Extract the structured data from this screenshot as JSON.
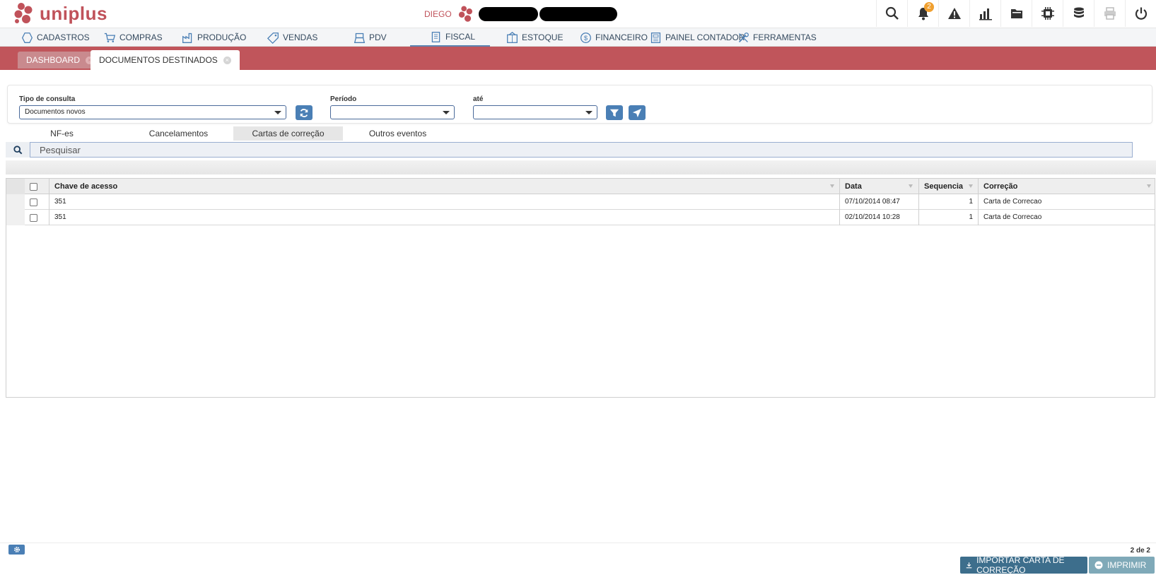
{
  "app": {
    "brand": "uniplus",
    "user_name": "DIEGO",
    "notification_count": "2",
    "brand_color": "#c0525a"
  },
  "top_icons": [
    "search-icon",
    "bell-icon",
    "warning-icon",
    "chart-icon",
    "folder-icon",
    "chip-icon",
    "database-icon",
    "printer-icon",
    "power-icon"
  ],
  "menu": {
    "cadastros": "CADASTROS",
    "compras": "COMPRAS",
    "producao": "PRODUÇÃO",
    "vendas": "VENDAS",
    "pdv": "PDV",
    "fiscal": "FISCAL",
    "estoque": "ESTOQUE",
    "financeiro": "FINANCEIRO",
    "painel_contador": "PAINEL CONTADOR",
    "ferramentas": "FERRAMENTAS",
    "active": "FISCAL"
  },
  "tabs": {
    "dashboard": "DASHBOARD",
    "documentos": "DOCUMENTOS DESTINADOS"
  },
  "filters": {
    "tipo_label": "Tipo de consulta",
    "tipo_value": "Documentos novos",
    "periodo_label": "Período",
    "periodo_value": "",
    "ate_label": "até",
    "ate_value": ""
  },
  "subtabs": {
    "nfes": "NF-es",
    "cancelamentos": "Cancelamentos",
    "cartas": "Cartas de correção",
    "outros": "Outros eventos",
    "active": "Cartas de correção"
  },
  "search": {
    "placeholder": "Pesquisar"
  },
  "grid": {
    "columns": {
      "chave": "Chave de acesso",
      "data": "Data",
      "sequencia": "Sequencia",
      "correcao": "Correção"
    },
    "rows": [
      {
        "chave": "351",
        "data": "07/10/2014 08:47",
        "sequencia": "1",
        "correcao": "Carta de Correcao"
      },
      {
        "chave": "351",
        "data": "02/10/2014 10:28",
        "sequencia": "1",
        "correcao": "Carta de Correcao"
      }
    ]
  },
  "footer": {
    "count": "2 de 2",
    "import_label": "IMPORTAR CARTA DE CORREÇÃO",
    "print_label": "IMPRIMIR"
  }
}
